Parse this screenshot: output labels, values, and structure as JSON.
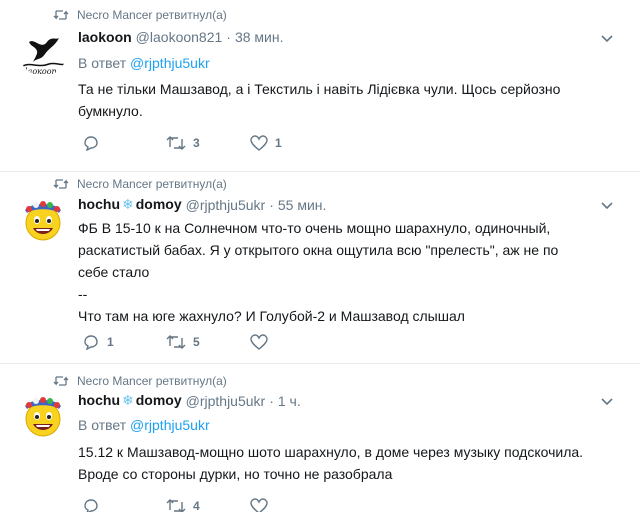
{
  "tweets": [
    {
      "retweeter": "Necro Mancer ретвитнул(а)",
      "name": "laokoon",
      "name_suffix": "",
      "handle": "@laokoon821",
      "dot": "·",
      "time": "38 мин.",
      "reply_prefix": "В ответ ",
      "reply_handle": "@rjpthju5ukr",
      "text_lines": [
        "Та не тільки Машзавод, а і Текстиль і навіть Лідієвка чули. Щось серйозно",
        "бумкнуло."
      ],
      "reply_count": "",
      "retweet_count": "3",
      "like_count": "1"
    },
    {
      "retweeter": "Necro Mancer ретвитнул(а)",
      "name": "hochu",
      "name_suffix": "domoy",
      "handle": "@rjpthju5ukr",
      "dot": "·",
      "time": "55 мин.",
      "reply_prefix": "",
      "reply_handle": "",
      "text_lines": [
        "ФБ В 15-10 к на Солнечном что-то очень мощно шарахнуло, одиночный,",
        "раскатистый бабах. Я у открытого окна ощутила всю \"прелесть\", аж не по",
        "себе стало",
        "--",
        "Что там на юге жахнуло? И Голубой-2 и Машзавод слышал"
      ],
      "reply_count": "1",
      "retweet_count": "5",
      "like_count": ""
    },
    {
      "retweeter": "Necro Mancer ретвитнул(а)",
      "name": "hochu",
      "name_suffix": "domoy",
      "handle": "@rjpthju5ukr",
      "dot": "·",
      "time": "1 ч.",
      "reply_prefix": "В ответ ",
      "reply_handle": "@rjpthju5ukr",
      "text_lines": [
        "15.12 к Машзавод-мощно шото шарахнуло, в доме через музыку подскочила.",
        "Вроде со стороны дурки, но точно не разобрала"
      ],
      "reply_count": "",
      "retweet_count": "4",
      "like_count": ""
    }
  ],
  "colors": {
    "link": "#1da1f2",
    "muted": "#657786",
    "text": "#14171a",
    "divider": "#e6ecf0"
  },
  "icons": {
    "retweet": "retweet-icon",
    "reply": "reply-icon",
    "like": "heart-icon",
    "menu": "chevron-down-icon",
    "snow": "snowflake-icon"
  }
}
